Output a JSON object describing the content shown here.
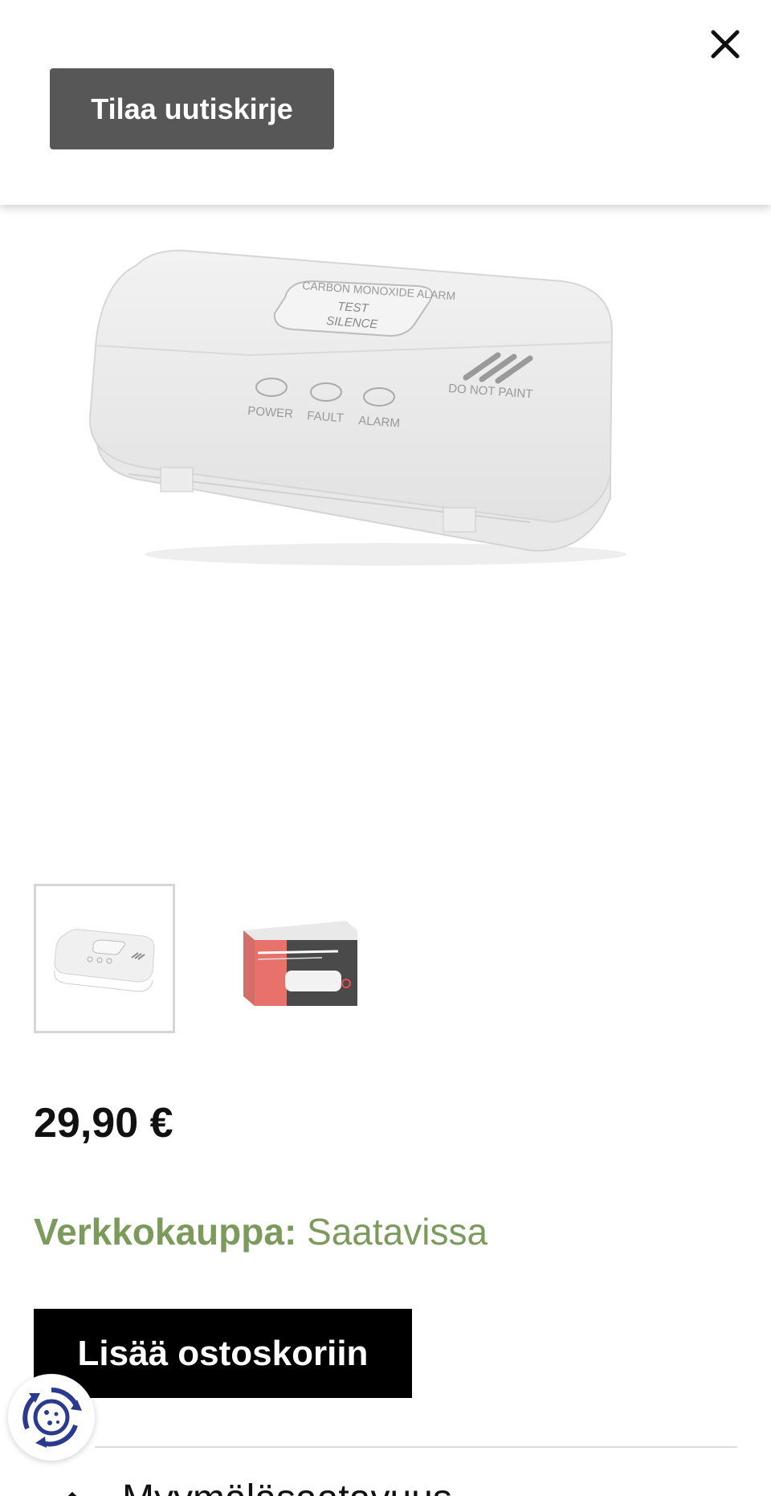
{
  "header": {
    "newsletter_label": "Tilaa uutiskirje"
  },
  "product": {
    "image_texts": {
      "title": "CARBON MONOXIDE ALARM",
      "test": "TEST",
      "silence": "SILENCE",
      "power": "POWER",
      "fault": "FAULT",
      "alarm": "ALARM",
      "do_not_paint": "DO NOT PAINT"
    },
    "thumbnails": [
      {
        "name": "alarm-device",
        "active": true
      },
      {
        "name": "alarm-package",
        "active": false
      }
    ],
    "price": "29,90 €",
    "availability": {
      "label": "Verkkokauppa:",
      "value": "Saatavissa"
    },
    "add_to_cart_label": "Lisää ostoskoriin",
    "next_section_label": "Myymäläsaatavuus"
  },
  "colors": {
    "button_dark": "#575757",
    "availability_green": "#7b9a5b",
    "cart_button": "#000000",
    "cookie_icon_blue": "#2b3a8f"
  },
  "icons": {
    "close": "close-icon",
    "cookie": "cookie-settings-icon",
    "chevron": "chevron-icon"
  }
}
